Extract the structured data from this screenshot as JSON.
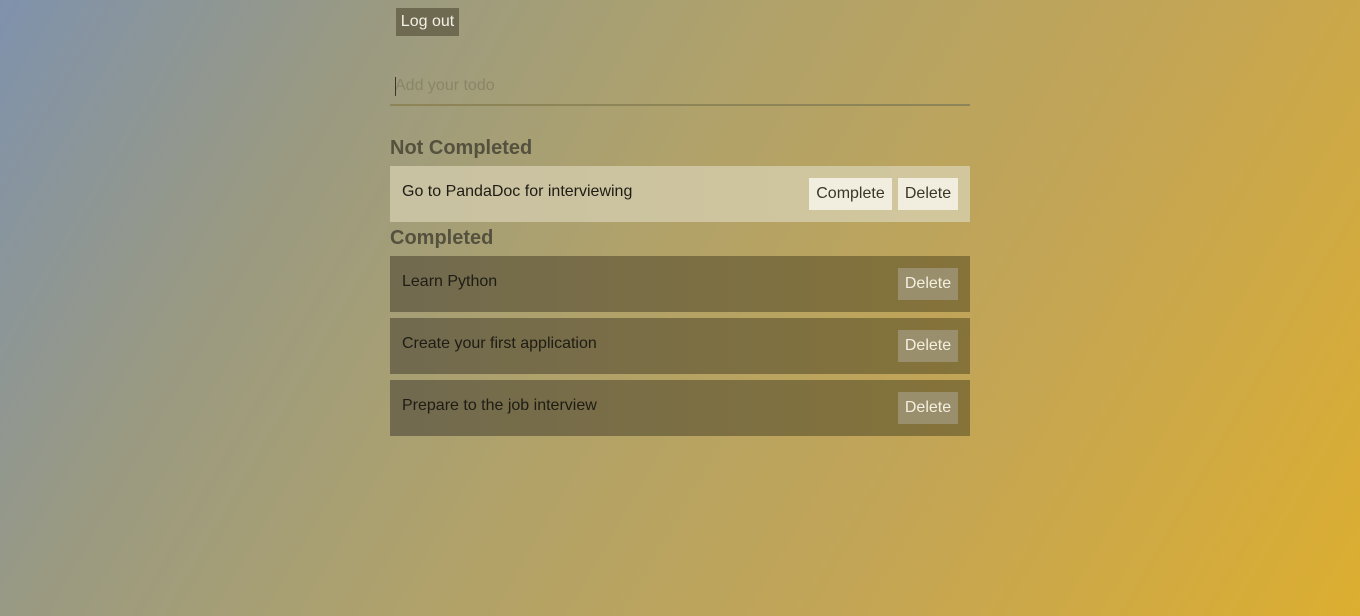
{
  "header": {
    "logout_label": "Log out"
  },
  "todo_input": {
    "placeholder": "Add your todo",
    "value": ""
  },
  "sections": {
    "not_completed_title": "Not Completed",
    "completed_title": "Completed"
  },
  "not_completed": [
    {
      "text": "Go to PandaDoc for interviewing",
      "complete_label": "Complete",
      "delete_label": "Delete"
    }
  ],
  "completed": [
    {
      "text": "Learn Python",
      "delete_label": "Delete"
    },
    {
      "text": "Create your first application",
      "delete_label": "Delete"
    },
    {
      "text": "Prepare to the job interview",
      "delete_label": "Delete"
    }
  ]
}
